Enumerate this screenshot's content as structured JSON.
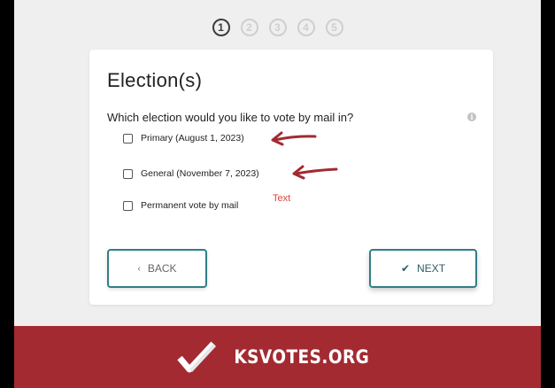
{
  "progress": {
    "steps": [
      "1",
      "2",
      "3",
      "4",
      "5"
    ],
    "current_step": 1
  },
  "card": {
    "title": "Election(s)",
    "question": "Which election would you like to vote by mail in?",
    "info_icon": "i",
    "options": [
      {
        "label": "Primary (August 1, 2023)",
        "checked": false
      },
      {
        "label": "General (November 7, 2023)",
        "checked": false
      },
      {
        "label": "Permanent vote by mail",
        "checked": false
      }
    ]
  },
  "annotation": {
    "text": "Text",
    "color": "#e5443a"
  },
  "buttons": {
    "back_label": "BACK",
    "back_icon": "‹",
    "next_label": "NEXT",
    "next_icon": "✔"
  },
  "footer": {
    "brand": "KSVOTES.ORG",
    "background_color": "#a32a31"
  },
  "colors": {
    "accent": "#2f7f86",
    "annotation_arrow": "#a32a31"
  }
}
